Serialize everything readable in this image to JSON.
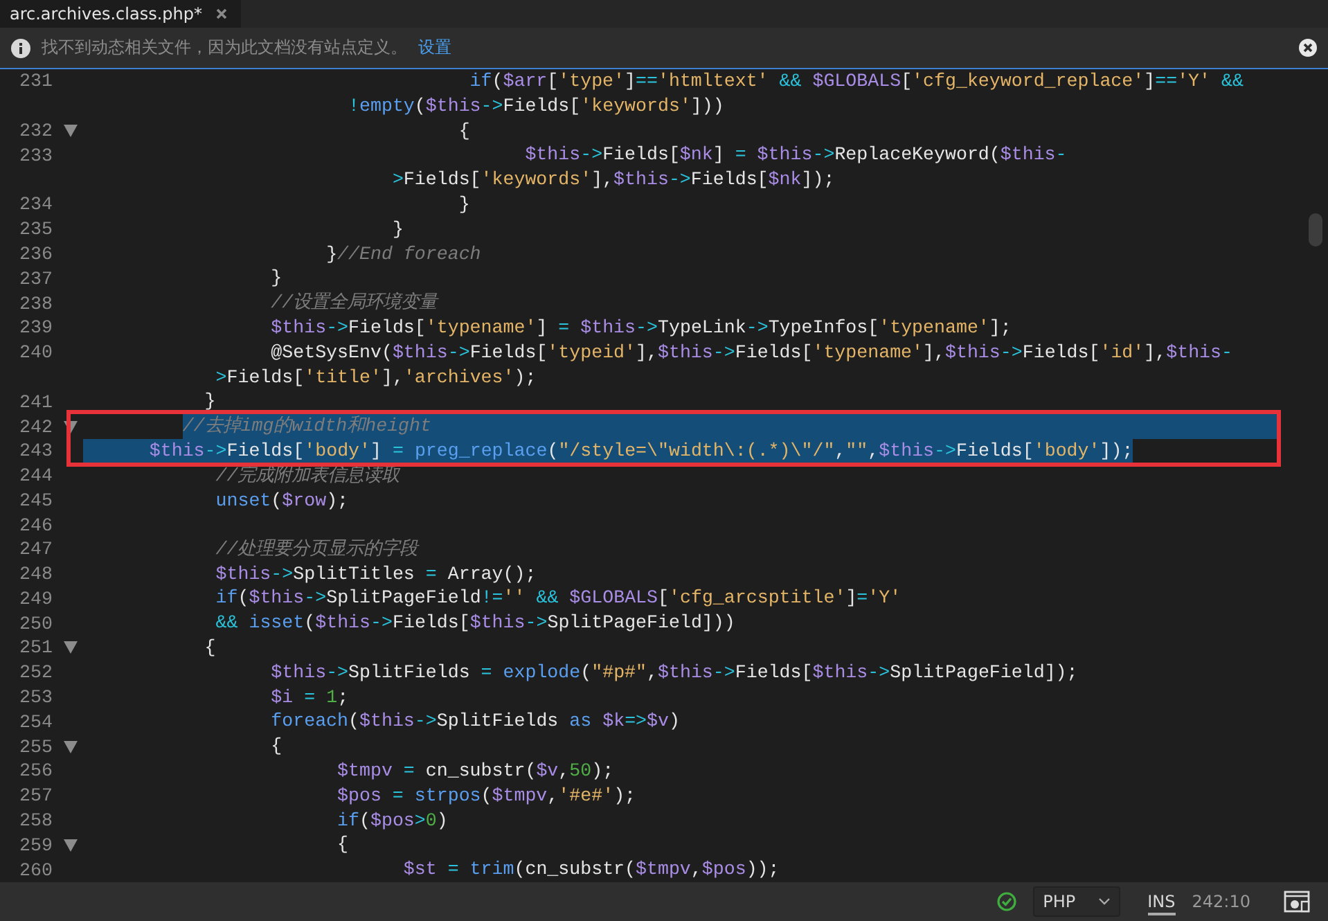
{
  "tab": {
    "title": "arc.archives.class.php*",
    "selected": true
  },
  "info_bar": {
    "message": "找不到动态相关文件，因为此文档没有站点定义。",
    "link": "设置"
  },
  "rows": [
    {
      "number": "231",
      "foldable": false,
      "selected": false,
      "boxed": false,
      "segments": [
        [
          {
            "kind": "k",
            "text": "                                   if"
          },
          {
            "kind": "p",
            "text": "("
          },
          {
            "kind": "v",
            "text": "$arr"
          },
          {
            "kind": "p",
            "text": "["
          },
          {
            "kind": "s",
            "text": "'type'"
          },
          {
            "kind": "p",
            "text": "]"
          },
          {
            "kind": "o",
            "text": "=="
          },
          {
            "kind": "s",
            "text": "'htmltext'"
          },
          {
            "kind": "o",
            "text": " &&"
          },
          {
            "kind": "v",
            "text": " $GLOBALS"
          },
          {
            "kind": "p",
            "text": "["
          },
          {
            "kind": "s",
            "text": "'cfg_keyword_replace'"
          },
          {
            "kind": "p",
            "text": "]"
          },
          {
            "kind": "o",
            "text": "=="
          },
          {
            "kind": "s",
            "text": "'Y'"
          },
          {
            "kind": "o",
            "text": " &&"
          }
        ],
        [
          {
            "kind": "o",
            "text": "                        !"
          },
          {
            "kind": "k",
            "text": "empty"
          },
          {
            "kind": "p",
            "text": "("
          },
          {
            "kind": "v",
            "text": "$this"
          },
          {
            "kind": "o",
            "text": "->"
          },
          {
            "kind": "p",
            "text": "Fields["
          },
          {
            "kind": "s",
            "text": "'keywords'"
          },
          {
            "kind": "p",
            "text": "]))"
          }
        ]
      ]
    },
    {
      "number": "232",
      "foldable": true,
      "selected": false,
      "boxed": false,
      "segments": [
        [
          {
            "kind": "p",
            "text": "                                  {"
          }
        ]
      ]
    },
    {
      "number": "233",
      "foldable": false,
      "selected": false,
      "boxed": false,
      "segments": [
        [
          {
            "kind": "v",
            "text": "                                        $this"
          },
          {
            "kind": "o",
            "text": "->"
          },
          {
            "kind": "p",
            "text": "Fields["
          },
          {
            "kind": "v",
            "text": "$nk"
          },
          {
            "kind": "p",
            "text": "] "
          },
          {
            "kind": "o",
            "text": "="
          },
          {
            "kind": "v",
            "text": " $this"
          },
          {
            "kind": "o",
            "text": "->"
          },
          {
            "kind": "p",
            "text": "ReplaceKeyword("
          },
          {
            "kind": "v",
            "text": "$this"
          },
          {
            "kind": "o",
            "text": "-"
          }
        ],
        [
          {
            "kind": "o",
            "text": "                            >"
          },
          {
            "kind": "p",
            "text": "Fields["
          },
          {
            "kind": "s",
            "text": "'keywords'"
          },
          {
            "kind": "p",
            "text": "],"
          },
          {
            "kind": "v",
            "text": "$this"
          },
          {
            "kind": "o",
            "text": "->"
          },
          {
            "kind": "p",
            "text": "Fields["
          },
          {
            "kind": "v",
            "text": "$nk"
          },
          {
            "kind": "p",
            "text": "]);"
          }
        ]
      ]
    },
    {
      "number": "234",
      "foldable": false,
      "selected": false,
      "boxed": false,
      "segments": [
        [
          {
            "kind": "p",
            "text": "                                  }"
          }
        ]
      ]
    },
    {
      "number": "235",
      "foldable": false,
      "selected": false,
      "boxed": false,
      "segments": [
        [
          {
            "kind": "p",
            "text": "                            }"
          }
        ]
      ]
    },
    {
      "number": "236",
      "foldable": false,
      "selected": false,
      "boxed": false,
      "segments": [
        [
          {
            "kind": "p",
            "text": "                      }"
          },
          {
            "kind": "c",
            "text": "//End foreach"
          }
        ]
      ]
    },
    {
      "number": "237",
      "foldable": false,
      "selected": false,
      "boxed": false,
      "segments": [
        [
          {
            "kind": "p",
            "text": "                 }"
          }
        ]
      ]
    },
    {
      "number": "238",
      "foldable": false,
      "selected": false,
      "boxed": false,
      "segments": [
        [
          {
            "kind": "c",
            "text": "                 //设置全局环境变量"
          }
        ]
      ]
    },
    {
      "number": "239",
      "foldable": false,
      "selected": false,
      "boxed": false,
      "segments": [
        [
          {
            "kind": "v",
            "text": "                 $this"
          },
          {
            "kind": "o",
            "text": "->"
          },
          {
            "kind": "p",
            "text": "Fields["
          },
          {
            "kind": "s",
            "text": "'typename'"
          },
          {
            "kind": "p",
            "text": "] "
          },
          {
            "kind": "o",
            "text": "="
          },
          {
            "kind": "v",
            "text": " $this"
          },
          {
            "kind": "o",
            "text": "->"
          },
          {
            "kind": "p",
            "text": "TypeLink"
          },
          {
            "kind": "o",
            "text": "->"
          },
          {
            "kind": "p",
            "text": "TypeInfos["
          },
          {
            "kind": "s",
            "text": "'typename'"
          },
          {
            "kind": "p",
            "text": "];"
          }
        ]
      ]
    },
    {
      "number": "240",
      "foldable": false,
      "selected": false,
      "boxed": false,
      "segments": [
        [
          {
            "kind": "p",
            "text": "                 @SetSysEnv("
          },
          {
            "kind": "v",
            "text": "$this"
          },
          {
            "kind": "o",
            "text": "->"
          },
          {
            "kind": "p",
            "text": "Fields["
          },
          {
            "kind": "s",
            "text": "'typeid'"
          },
          {
            "kind": "p",
            "text": "],"
          },
          {
            "kind": "v",
            "text": "$this"
          },
          {
            "kind": "o",
            "text": "->"
          },
          {
            "kind": "p",
            "text": "Fields["
          },
          {
            "kind": "s",
            "text": "'typename'"
          },
          {
            "kind": "p",
            "text": "],"
          },
          {
            "kind": "v",
            "text": "$this"
          },
          {
            "kind": "o",
            "text": "->"
          },
          {
            "kind": "p",
            "text": "Fields["
          },
          {
            "kind": "s",
            "text": "'id'"
          },
          {
            "kind": "p",
            "text": "],"
          },
          {
            "kind": "v",
            "text": "$this"
          },
          {
            "kind": "o",
            "text": "-"
          }
        ],
        [
          {
            "kind": "o",
            "text": "            >"
          },
          {
            "kind": "p",
            "text": "Fields["
          },
          {
            "kind": "s",
            "text": "'title'"
          },
          {
            "kind": "p",
            "text": "],"
          },
          {
            "kind": "s",
            "text": "'archives'"
          },
          {
            "kind": "p",
            "text": ");"
          }
        ]
      ]
    },
    {
      "number": "241",
      "foldable": false,
      "selected": false,
      "boxed": false,
      "segments": [
        [
          {
            "kind": "p",
            "text": "           }"
          }
        ]
      ]
    },
    {
      "number": "242",
      "foldable": true,
      "selected": true,
      "boxed": true,
      "segments": [
        [
          {
            "kind": "c",
            "text": "         //去掉img的width和height"
          }
        ]
      ]
    },
    {
      "number": "243",
      "foldable": false,
      "selected": true,
      "boxed": true,
      "segments": [
        [
          {
            "kind": "v",
            "text": "      $this"
          },
          {
            "kind": "o",
            "text": "->"
          },
          {
            "kind": "p",
            "text": "Fields["
          },
          {
            "kind": "s",
            "text": "'body'"
          },
          {
            "kind": "p",
            "text": "] "
          },
          {
            "kind": "o",
            "text": "="
          },
          {
            "kind": "k",
            "text": " preg_replace"
          },
          {
            "kind": "p",
            "text": "("
          },
          {
            "kind": "s",
            "text": "\"/style=\\\"width\\:(.*)\\\"/\""
          },
          {
            "kind": "p",
            "text": ","
          },
          {
            "kind": "s",
            "text": "\"\""
          },
          {
            "kind": "p",
            "text": ","
          },
          {
            "kind": "v",
            "text": "$this"
          },
          {
            "kind": "o",
            "text": "->"
          },
          {
            "kind": "p",
            "text": "Fields["
          },
          {
            "kind": "s",
            "text": "'body'"
          },
          {
            "kind": "p",
            "text": "]);"
          }
        ]
      ]
    },
    {
      "number": "244",
      "foldable": false,
      "selected": false,
      "boxed": false,
      "segments": [
        [
          {
            "kind": "c",
            "text": "            //完成附加表信息读取"
          }
        ]
      ]
    },
    {
      "number": "245",
      "foldable": false,
      "selected": false,
      "boxed": false,
      "segments": [
        [
          {
            "kind": "k",
            "text": "            unset"
          },
          {
            "kind": "p",
            "text": "("
          },
          {
            "kind": "v",
            "text": "$row"
          },
          {
            "kind": "p",
            "text": ");"
          }
        ]
      ]
    },
    {
      "number": "246",
      "foldable": false,
      "selected": false,
      "boxed": false
    },
    {
      "number": "247",
      "foldable": false,
      "selected": false,
      "boxed": false,
      "segments": [
        [
          {
            "kind": "c",
            "text": "            //处理要分页显示的字段"
          }
        ]
      ]
    },
    {
      "number": "248",
      "foldable": false,
      "selected": false,
      "boxed": false,
      "segments": [
        [
          {
            "kind": "v",
            "text": "            $this"
          },
          {
            "kind": "o",
            "text": "->"
          },
          {
            "kind": "p",
            "text": "SplitTitles "
          },
          {
            "kind": "o",
            "text": "="
          },
          {
            "kind": "p",
            "text": " Array();"
          }
        ]
      ]
    },
    {
      "number": "249",
      "foldable": false,
      "selected": false,
      "boxed": false,
      "segments": [
        [
          {
            "kind": "k",
            "text": "            if"
          },
          {
            "kind": "p",
            "text": "("
          },
          {
            "kind": "v",
            "text": "$this"
          },
          {
            "kind": "o",
            "text": "->"
          },
          {
            "kind": "p",
            "text": "SplitPageField"
          },
          {
            "kind": "o",
            "text": "!="
          },
          {
            "kind": "s",
            "text": "''"
          },
          {
            "kind": "o",
            "text": " &&"
          },
          {
            "kind": "v",
            "text": " $GLOBALS"
          },
          {
            "kind": "p",
            "text": "["
          },
          {
            "kind": "s",
            "text": "'cfg_arcsptitle'"
          },
          {
            "kind": "p",
            "text": "]"
          },
          {
            "kind": "o",
            "text": "="
          },
          {
            "kind": "s",
            "text": "'Y'"
          }
        ]
      ]
    },
    {
      "number": "250",
      "foldable": false,
      "selected": false,
      "boxed": false,
      "segments": [
        [
          {
            "kind": "o",
            "text": "            &&"
          },
          {
            "kind": "k",
            "text": " isset"
          },
          {
            "kind": "p",
            "text": "("
          },
          {
            "kind": "v",
            "text": "$this"
          },
          {
            "kind": "o",
            "text": "->"
          },
          {
            "kind": "p",
            "text": "Fields["
          },
          {
            "kind": "v",
            "text": "$this"
          },
          {
            "kind": "o",
            "text": "->"
          },
          {
            "kind": "p",
            "text": "SplitPageField]))"
          }
        ]
      ]
    },
    {
      "number": "251",
      "foldable": true,
      "selected": false,
      "boxed": false,
      "segments": [
        [
          {
            "kind": "p",
            "text": "           {"
          }
        ]
      ]
    },
    {
      "number": "252",
      "foldable": false,
      "selected": false,
      "boxed": false,
      "segments": [
        [
          {
            "kind": "v",
            "text": "                 $this"
          },
          {
            "kind": "o",
            "text": "->"
          },
          {
            "kind": "p",
            "text": "SplitFields "
          },
          {
            "kind": "o",
            "text": "="
          },
          {
            "kind": "k",
            "text": " explode"
          },
          {
            "kind": "p",
            "text": "("
          },
          {
            "kind": "s",
            "text": "\"#p#\""
          },
          {
            "kind": "p",
            "text": ","
          },
          {
            "kind": "v",
            "text": "$this"
          },
          {
            "kind": "o",
            "text": "->"
          },
          {
            "kind": "p",
            "text": "Fields["
          },
          {
            "kind": "v",
            "text": "$this"
          },
          {
            "kind": "o",
            "text": "->"
          },
          {
            "kind": "p",
            "text": "SplitPageField]);"
          }
        ]
      ]
    },
    {
      "number": "253",
      "foldable": false,
      "selected": false,
      "boxed": false,
      "segments": [
        [
          {
            "kind": "v",
            "text": "                 $i"
          },
          {
            "kind": "o",
            "text": " ="
          },
          {
            "kind": "n",
            "text": " 1"
          },
          {
            "kind": "p",
            "text": ";"
          }
        ]
      ]
    },
    {
      "number": "254",
      "foldable": false,
      "selected": false,
      "boxed": false,
      "segments": [
        [
          {
            "kind": "k",
            "text": "                 foreach"
          },
          {
            "kind": "p",
            "text": "("
          },
          {
            "kind": "v",
            "text": "$this"
          },
          {
            "kind": "o",
            "text": "->"
          },
          {
            "kind": "p",
            "text": "SplitFields "
          },
          {
            "kind": "k",
            "text": "as"
          },
          {
            "kind": "v",
            "text": " $k"
          },
          {
            "kind": "o",
            "text": "=>"
          },
          {
            "kind": "v",
            "text": "$v"
          },
          {
            "kind": "p",
            "text": ")"
          }
        ]
      ]
    },
    {
      "number": "255",
      "foldable": true,
      "selected": false,
      "boxed": false,
      "segments": [
        [
          {
            "kind": "p",
            "text": "                 {"
          }
        ]
      ]
    },
    {
      "number": "256",
      "foldable": false,
      "selected": false,
      "boxed": false,
      "segments": [
        [
          {
            "kind": "v",
            "text": "                       $tmpv"
          },
          {
            "kind": "o",
            "text": " ="
          },
          {
            "kind": "p",
            "text": " cn_substr("
          },
          {
            "kind": "v",
            "text": "$v"
          },
          {
            "kind": "p",
            "text": ","
          },
          {
            "kind": "n",
            "text": "50"
          },
          {
            "kind": "p",
            "text": ");"
          }
        ]
      ]
    },
    {
      "number": "257",
      "foldable": false,
      "selected": false,
      "boxed": false,
      "segments": [
        [
          {
            "kind": "v",
            "text": "                       $pos"
          },
          {
            "kind": "o",
            "text": " ="
          },
          {
            "kind": "k",
            "text": " strpos"
          },
          {
            "kind": "p",
            "text": "("
          },
          {
            "kind": "v",
            "text": "$tmpv"
          },
          {
            "kind": "p",
            "text": ","
          },
          {
            "kind": "s",
            "text": "'#e#'"
          },
          {
            "kind": "p",
            "text": ");"
          }
        ]
      ]
    },
    {
      "number": "258",
      "foldable": false,
      "selected": false,
      "boxed": false,
      "segments": [
        [
          {
            "kind": "k",
            "text": "                       if"
          },
          {
            "kind": "p",
            "text": "("
          },
          {
            "kind": "v",
            "text": "$pos"
          },
          {
            "kind": "o",
            "text": ">"
          },
          {
            "kind": "n",
            "text": "0"
          },
          {
            "kind": "p",
            "text": ")"
          }
        ]
      ]
    },
    {
      "number": "259",
      "foldable": true,
      "selected": false,
      "boxed": false,
      "segments": [
        [
          {
            "kind": "p",
            "text": "                       {"
          }
        ]
      ]
    },
    {
      "number": "260",
      "foldable": false,
      "selected": false,
      "boxed": false,
      "segments": [
        [
          {
            "kind": "v",
            "text": "                             $st"
          },
          {
            "kind": "o",
            "text": " ="
          },
          {
            "kind": "k",
            "text": " trim"
          },
          {
            "kind": "p",
            "text": "(cn_substr("
          },
          {
            "kind": "v",
            "text": "$tmpv"
          },
          {
            "kind": "p",
            "text": ","
          },
          {
            "kind": "v",
            "text": "$pos"
          },
          {
            "kind": "p",
            "text": "));"
          }
        ]
      ]
    }
  ],
  "status_bar": {
    "syntax_ok": true,
    "language": "PHP",
    "mode": "INS",
    "position": "242:10"
  }
}
